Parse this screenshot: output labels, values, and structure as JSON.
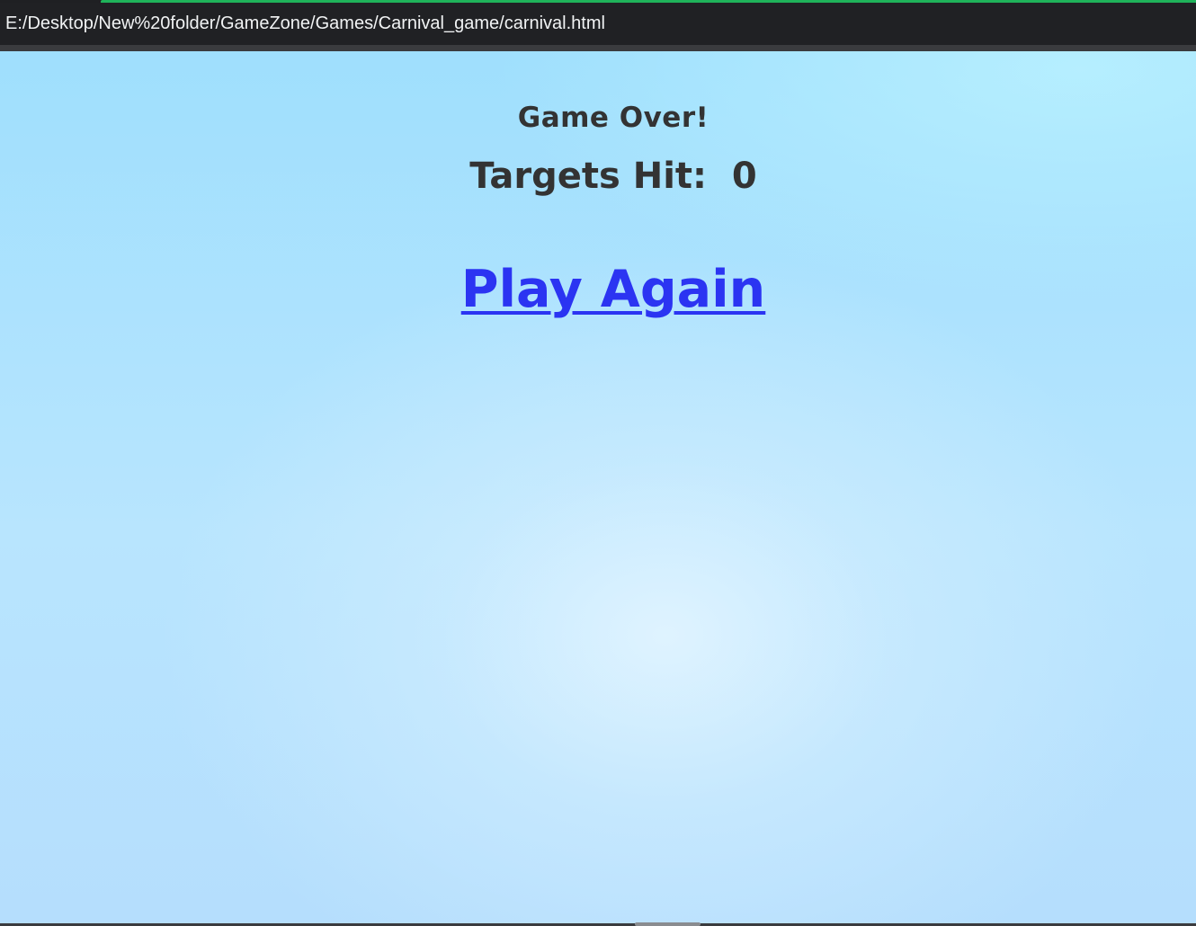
{
  "browser": {
    "address": "E:/Desktop/New%20folder/GameZone/Games/Carnival_game/carnival.html"
  },
  "game": {
    "title": "Game Over!",
    "score_label": "Targets Hit:",
    "score_value": "0",
    "play_again_label": "Play Again"
  },
  "colors": {
    "accent": "#1fb35a",
    "text": "#333333",
    "link": "#2b34f2",
    "background": "#aee2fd"
  }
}
